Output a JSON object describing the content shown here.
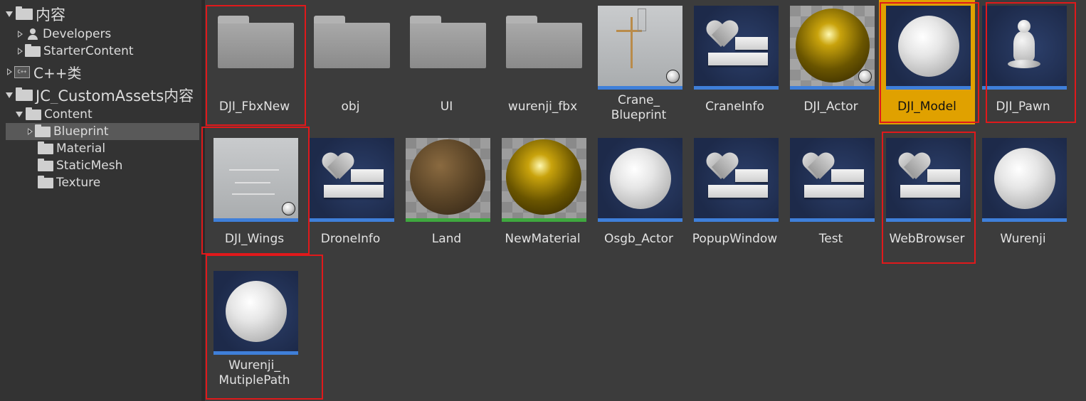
{
  "tree": {
    "items": [
      {
        "label": "内容",
        "arrow": "down",
        "icon": "folder-icon"
      },
      {
        "label": "Developers",
        "arrow": "right",
        "icon": "person-icon"
      },
      {
        "label": "StarterContent",
        "arrow": "right",
        "icon": "folder-icon"
      },
      {
        "label": "C++类",
        "arrow": "right",
        "icon": "cpp-class-icon"
      },
      {
        "label": "JC_CustomAssets内容",
        "arrow": "down",
        "icon": "folder-icon"
      },
      {
        "label": "Content",
        "arrow": "down",
        "icon": "folder-icon"
      },
      {
        "label": "Blueprint",
        "arrow": "right",
        "icon": "folder-icon",
        "selected": true
      },
      {
        "label": "Material",
        "icon": "folder-icon"
      },
      {
        "label": "StaticMesh",
        "icon": "folder-icon"
      },
      {
        "label": "Texture",
        "icon": "folder-icon"
      }
    ]
  },
  "assets": [
    {
      "label": "DJI_FbxNew",
      "kind": "folder"
    },
    {
      "label": "obj",
      "kind": "folder"
    },
    {
      "label": "UI",
      "kind": "folder"
    },
    {
      "label": "wurenji_fbx",
      "kind": "folder"
    },
    {
      "label": "Crane_\nBlueprint",
      "kind": "level",
      "bar": "#3f7fd9"
    },
    {
      "label": "CraneInfo",
      "kind": "struct",
      "bar": "#3f7fd9"
    },
    {
      "label": "DJI_Actor",
      "kind": "gold-sphere",
      "bar": "#3f7fd9"
    },
    {
      "label": "DJI_Model",
      "kind": "white-sphere",
      "bar": "#3f7fd9",
      "selected": true
    },
    {
      "label": "DJI_Pawn",
      "kind": "pawn",
      "bar": "#3f7fd9"
    },
    {
      "label": "DJI_Wings",
      "kind": "wings",
      "bar": "#3f7fd9"
    },
    {
      "label": "DroneInfo",
      "kind": "struct",
      "bar": "#3f7fd9"
    },
    {
      "label": "Land",
      "kind": "brown-sphere",
      "bar": "#3fa83f"
    },
    {
      "label": "NewMaterial",
      "kind": "gold-material",
      "bar": "#3fa83f"
    },
    {
      "label": "Osgb_Actor",
      "kind": "white-sphere",
      "bar": "#3f7fd9"
    },
    {
      "label": "PopupWindow",
      "kind": "struct",
      "bar": "#3f7fd9"
    },
    {
      "label": "Test",
      "kind": "struct",
      "bar": "#3f7fd9"
    },
    {
      "label": "WebBrowser",
      "kind": "struct",
      "bar": "#3f7fd9"
    },
    {
      "label": "Wurenji",
      "kind": "white-sphere",
      "bar": "#3f7fd9"
    },
    {
      "label": "Wurenji_\nMutiplePath",
      "kind": "white-sphere",
      "bar": "#3f7fd9"
    }
  ],
  "colors": {
    "blueprint_bar": "#3f7fd9",
    "material_bar": "#3fa83f",
    "selection": "#e0a100",
    "highlight_box": "#e0191b"
  }
}
